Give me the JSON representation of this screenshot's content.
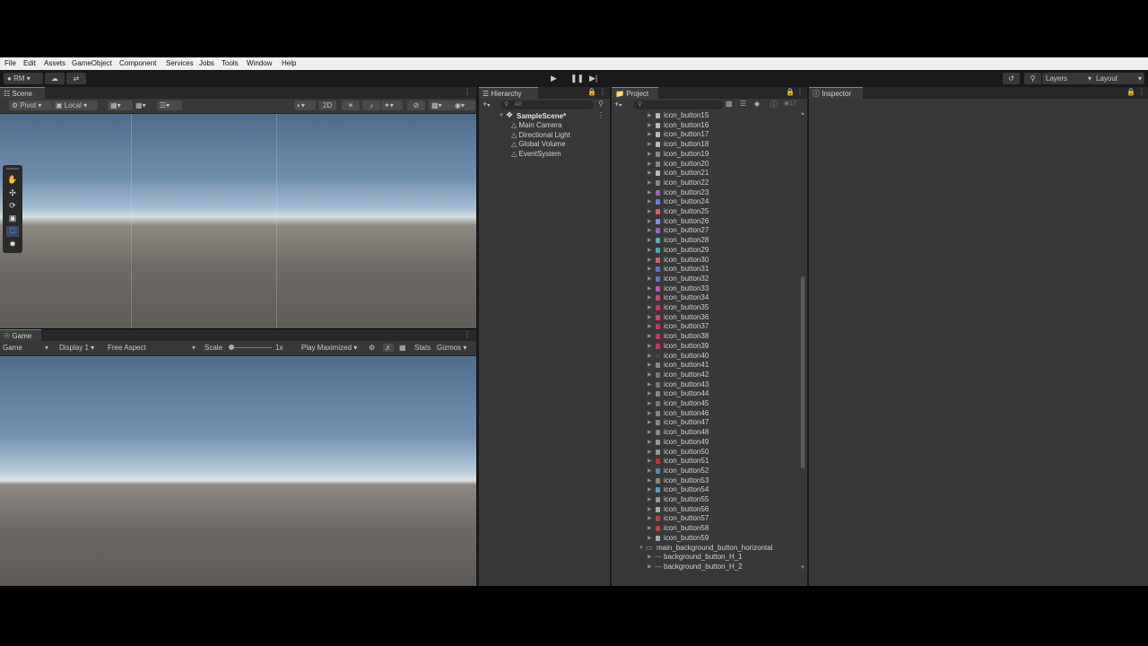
{
  "menu": [
    "File",
    "Edit",
    "Assets",
    "GameObject",
    "Component",
    "Services",
    "Jobs",
    "Tools",
    "Window",
    "Help"
  ],
  "toolbar": {
    "account": "RM",
    "layers": "Layers",
    "layout": "Layout",
    "play_icon": "play-icon",
    "pause_icon": "pause-icon",
    "step_icon": "step-icon"
  },
  "scene": {
    "tab": "Scene",
    "pivot": "Pivot",
    "local": "Local",
    "mode_2d": "2D"
  },
  "game": {
    "tab": "Game",
    "view": "Game",
    "display": "Display 1",
    "aspect": "Free Aspect",
    "scale_label": "Scale",
    "scale_value": "1x",
    "play_mode": "Play Maximized",
    "stats": "Stats",
    "gizmos": "Gizmos"
  },
  "hierarchy": {
    "tab": "Hierarchy",
    "search_placeholder": "All",
    "scene_name": "SampleScene*",
    "items": [
      "Main Camera",
      "Directional Light",
      "Global Volume",
      "EventSystem"
    ]
  },
  "project": {
    "tab": "Project",
    "hidden_count": "17",
    "items": [
      {
        "name": "icon_button15",
        "color": "#bbbbbb"
      },
      {
        "name": "icon_button16",
        "color": "#bbbbbb"
      },
      {
        "name": "icon_button17",
        "color": "#bbbbbb"
      },
      {
        "name": "icon_button18",
        "color": "#bbbbbb"
      },
      {
        "name": "icon_button19",
        "color": "#888888"
      },
      {
        "name": "icon_button20",
        "color": "#888888"
      },
      {
        "name": "icon_button21",
        "color": "#bbbbbb"
      },
      {
        "name": "icon_button22",
        "color": "#888888"
      },
      {
        "name": "icon_button23",
        "color": "#a060c0"
      },
      {
        "name": "icon_button24",
        "color": "#6080d0"
      },
      {
        "name": "icon_button25",
        "color": "#d06070"
      },
      {
        "name": "icon_button26",
        "color": "#8090d0"
      },
      {
        "name": "icon_button27",
        "color": "#a060c0"
      },
      {
        "name": "icon_button28",
        "color": "#50b0b0"
      },
      {
        "name": "icon_button29",
        "color": "#50a0c0"
      },
      {
        "name": "icon_button30",
        "color": "#d06070"
      },
      {
        "name": "icon_button31",
        "color": "#6070d0"
      },
      {
        "name": "icon_button32",
        "color": "#6070d0"
      },
      {
        "name": "icon_button33",
        "color": "#c050c0"
      },
      {
        "name": "icon_button34",
        "color": "#d04080"
      },
      {
        "name": "icon_button35",
        "color": "#d03060"
      },
      {
        "name": "icon_button36",
        "color": "#d04080"
      },
      {
        "name": "icon_button37",
        "color": "#d03060"
      },
      {
        "name": "icon_button38",
        "color": "#d03060"
      },
      {
        "name": "icon_button39",
        "color": "#d03060"
      },
      {
        "name": "icon_button40",
        "color": "#444444"
      },
      {
        "name": "icon_button41",
        "color": "#888888"
      },
      {
        "name": "icon_button42",
        "color": "#777777"
      },
      {
        "name": "icon_button43",
        "color": "#777777"
      },
      {
        "name": "icon_button44",
        "color": "#888888"
      },
      {
        "name": "icon_button45",
        "color": "#777777"
      },
      {
        "name": "icon_button46",
        "color": "#888888"
      },
      {
        "name": "icon_button47",
        "color": "#888888"
      },
      {
        "name": "icon_button48",
        "color": "#888888"
      },
      {
        "name": "icon_button49",
        "color": "#999999"
      },
      {
        "name": "icon_button50",
        "color": "#999999"
      },
      {
        "name": "icon_button51",
        "color": "#c03030"
      },
      {
        "name": "icon_button52",
        "color": "#6080b0"
      },
      {
        "name": "icon_button53",
        "color": "#888888"
      },
      {
        "name": "icon_button54",
        "color": "#50a0c0"
      },
      {
        "name": "icon_button55",
        "color": "#999999"
      },
      {
        "name": "icon_button56",
        "color": "#aaaaaa"
      },
      {
        "name": "icon_button57",
        "color": "#c04040"
      },
      {
        "name": "icon_button58",
        "color": "#c04040"
      },
      {
        "name": "icon_button59",
        "color": "#aaaaaa"
      }
    ],
    "folder": "main_background_button_horizontal",
    "sub_items": [
      "background_button_H_1",
      "background_button_H_2"
    ]
  },
  "inspector": {
    "tab": "Inspector"
  }
}
